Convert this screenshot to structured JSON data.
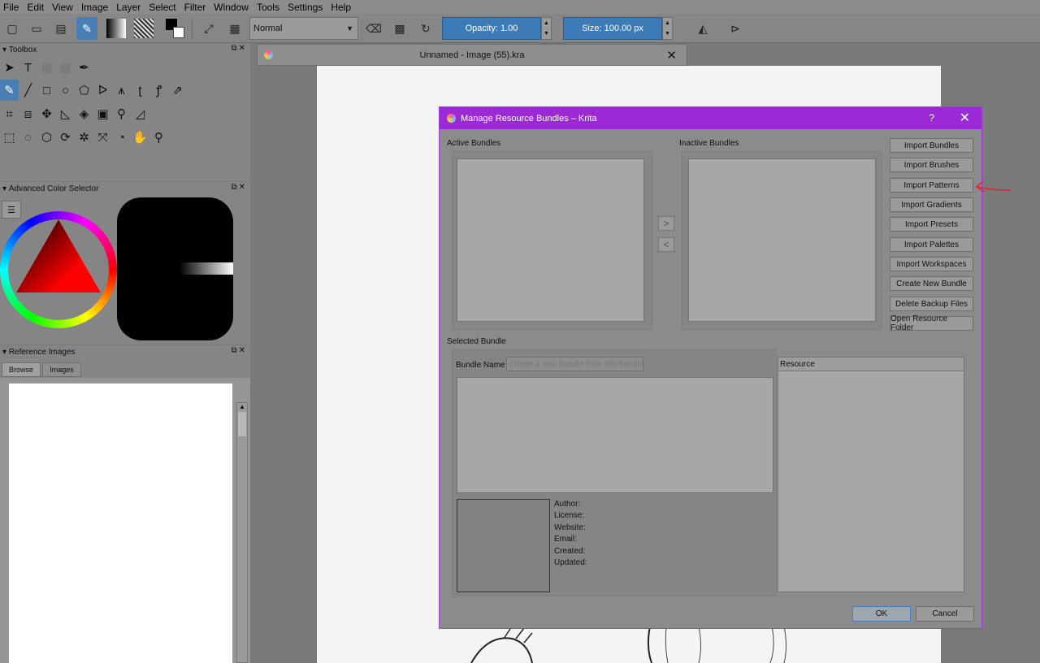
{
  "menu": [
    "File",
    "Edit",
    "View",
    "Image",
    "Layer",
    "Select",
    "Filter",
    "Window",
    "Tools",
    "Settings",
    "Help"
  ],
  "toolbar": {
    "blend_mode": "Normal",
    "opacity_label": "Opacity:  1.00",
    "size_label": "Size:  100.00 px"
  },
  "docks": {
    "toolbox_title": "Toolbox",
    "color_selector_title": "Advanced Color Selector",
    "reference_title": "Reference Images",
    "reference_tabs": [
      "Browse",
      "Images"
    ]
  },
  "document": {
    "tab_title": "Unnamed - Image (55).kra",
    "close_glyph": "✕"
  },
  "dialog": {
    "title": "Manage Resource Bundles – Krita",
    "help_glyph": "?",
    "close_glyph": "✕",
    "active_label": "Active Bundles",
    "inactive_label": "Inactive Bundles",
    "selected_label": "Selected Bundle",
    "bundle_name_label": "Bundle Name",
    "bundle_name_placeholder": "Create a new bundle from this bundle",
    "resource_header": "Resource",
    "side_buttons": [
      "Import Bundles",
      "Import Brushes",
      "Import Patterns",
      "Import Gradients",
      "Import Presets",
      "Import Palettes",
      "Import Workspaces",
      "Create New Bundle",
      "Delete Backup Files",
      "Open Resource Folder"
    ],
    "meta": [
      "Author:",
      "License:",
      "Website:",
      "Email:",
      "Created:",
      "Updated:"
    ],
    "ok_label": "OK",
    "cancel_label": "Cancel"
  },
  "colors": {
    "accent": "#4a7fb6",
    "dialog_title_bg": "#9b2ad6",
    "annotation_arrow": "#e0262b"
  }
}
